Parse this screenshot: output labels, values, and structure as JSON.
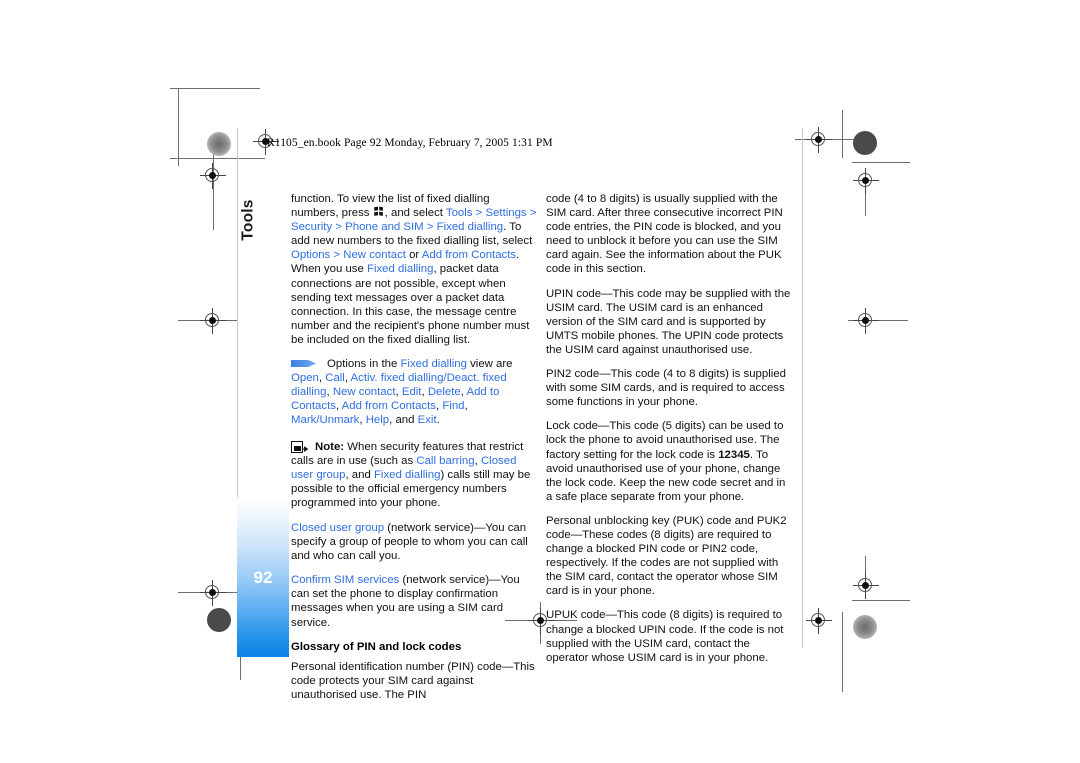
{
  "document": {
    "book_header": "R1105_en.book  Page 92  Monday, February 7, 2005  1:31 PM",
    "chapter_tab": "Tools",
    "page_number": "92",
    "link_color": "#2f6fe0",
    "tab_gradient_color": "#0b82e6"
  },
  "icons": {
    "menu_key": "nokia-menu-key-icon",
    "options_arrow": "blue-arrow-bullet-icon",
    "note": "note-phone-icon",
    "registration_target": "registration-target-icon",
    "density_dot": "print-density-dot-icon"
  },
  "left_column": {
    "para_fixed_dialling": {
      "t1": "function. To view the list of fixed dialling numbers, press ",
      "t2": ", and select ",
      "l1": "Tools",
      "t3": " > ",
      "l2": "Settings",
      "t4": " > ",
      "l3": "Security",
      "t5": " > ",
      "l4": "Phone and SIM",
      "t6": " > ",
      "l5": "Fixed dialling",
      "t7": ". To add new numbers to the fixed dialling list, select ",
      "l6": "Options",
      "t8": " > ",
      "l7": "New contact",
      "t9": " or ",
      "l8": "Add from Contacts",
      "t10": ". When you use ",
      "l9": "Fixed dialling",
      "t11": ", packet data connections are not possible, except when sending text messages over a packet data connection. In this case, the message centre number and the recipient's phone number must be included on the fixed dialling list."
    },
    "options_block": {
      "t1": "Options in the ",
      "l1": "Fixed dialling",
      "t2": " view are ",
      "l2": "Open",
      "t3": ", ",
      "l3": "Call",
      "t4": ", ",
      "l4": "Activ. fixed dialling",
      "t5": "/",
      "l5": "Deact. fixed dialling",
      "t6": ", ",
      "l6": "New contact",
      "t7": ", ",
      "l7": "Edit",
      "t8": ", ",
      "l8": "Delete",
      "t9": ", ",
      "l9": "Add to Contacts",
      "t10": ", ",
      "l10": "Add from Contacts",
      "t11": ", ",
      "l11": "Find",
      "t12": ", ",
      "l12": "Mark/Unmark",
      "t13": ", ",
      "l13": "Help",
      "t14": ", and ",
      "l14": "Exit",
      "t15": "."
    },
    "note_block": {
      "label": "Note:",
      "t1": " When security features that restrict calls are in use (such as ",
      "l1": "Call barring",
      "t2": ", ",
      "l2": "Closed user group",
      "t3": ", and ",
      "l3": "Fixed dialling",
      "t4": ") calls still may be possible to the official emergency numbers programmed into your phone."
    },
    "para_closed_user_group": {
      "l1": "Closed user group",
      "t1": " (network service)—You can specify a group of people to whom you can call and who can call you."
    },
    "para_confirm_sim": {
      "l1": "Confirm SIM services",
      "t1": " (network service)—You can set the phone to display confirmation messages when you are using a SIM card service."
    },
    "subhead_glossary": "Glossary of PIN and lock codes",
    "para_pin": "Personal identification number (PIN) code—This code protects your SIM card against unauthorised use. The PIN"
  },
  "right_column": {
    "para_pin_cont": "code (4 to 8 digits) is usually supplied with the SIM card. After three consecutive incorrect PIN code entries, the PIN code is blocked, and you need to unblock it before you can use the SIM card again. See the information about the PUK code in this section.",
    "para_upin": "UPIN code—This code may be supplied with the USIM card. The USIM card is an enhanced version of the SIM card and is supported by UMTS mobile phones. The UPIN code protects the USIM card against unauthorised use.",
    "para_pin2": "PIN2 code—This code (4 to 8 digits) is supplied with some SIM cards, and is required to access some functions in your phone.",
    "para_lock": {
      "t1": "Lock code—This code (5 digits) can be used to lock the phone to avoid unauthorised use. The factory setting for the lock code is ",
      "b1": "12345",
      "t2": ". To avoid unauthorised use of your phone, change the lock code. Keep the new code secret and in a safe place separate from your phone."
    },
    "para_puk": "Personal unblocking key (PUK) code and PUK2 code—These codes (8 digits) are required to change a blocked PIN code or PIN2 code, respectively. If the codes are not supplied with the SIM card, contact the operator whose SIM card is in your phone.",
    "para_upuk": "UPUK code—This code (8 digits) is required to change a blocked UPIN code. If the code is not supplied with the USIM card, contact the operator whose USIM card is in your phone."
  }
}
